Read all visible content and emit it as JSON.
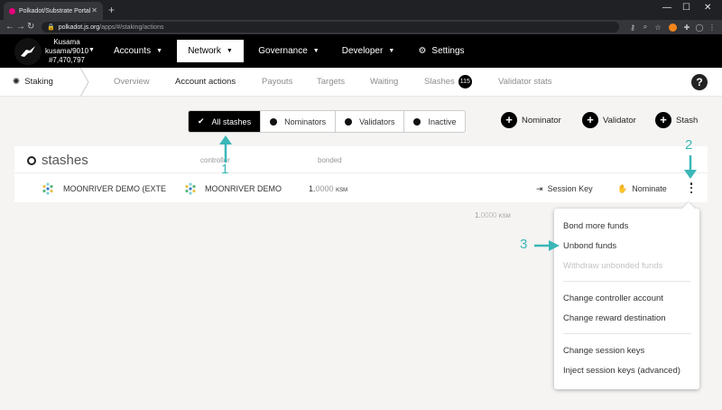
{
  "browser": {
    "tab_title": "Polkadot/Substrate Portal",
    "url_host": "polkadot.js.org",
    "url_path": "/apps/#/staking/actions"
  },
  "chain": {
    "name": "Kusama",
    "node": "kusama/9010",
    "block": "#7,470,797"
  },
  "menu": [
    {
      "label": "Accounts"
    },
    {
      "label": "Network"
    },
    {
      "label": "Governance"
    },
    {
      "label": "Developer"
    },
    {
      "label": "Settings"
    }
  ],
  "subnav": {
    "section": "Staking",
    "tabs": [
      "Overview",
      "Account actions",
      "Payouts",
      "Targets",
      "Waiting",
      "Slashes",
      "Validator stats"
    ],
    "slashes_count": "115"
  },
  "filters": [
    "All stashes",
    "Nominators",
    "Validators",
    "Inactive"
  ],
  "actions": [
    "Nominator",
    "Validator",
    "Stash"
  ],
  "table": {
    "title": "stashes",
    "col_controller": "controller",
    "col_bonded": "bonded",
    "row": {
      "stash": "MOONRIVER DEMO (EXTEN",
      "controller": "MOONRIVER DEMO",
      "bonded_int": "1.",
      "bonded_frac": "0000",
      "bonded_unit": "KSM",
      "session_key": "Session Key",
      "nominate": "Nominate"
    }
  },
  "total": {
    "int": "1.",
    "frac": "0000",
    "unit": "KSM"
  },
  "popup": {
    "items": [
      "Bond more funds",
      "Unbond funds",
      "Withdraw unbonded funds",
      "Change controller account",
      "Change reward destination",
      "Change session keys",
      "Inject session keys (advanced)"
    ]
  },
  "annotations": [
    "1",
    "2",
    "3"
  ],
  "colors": {
    "annotation": "#3ab7b7",
    "topbar": "#000000"
  }
}
